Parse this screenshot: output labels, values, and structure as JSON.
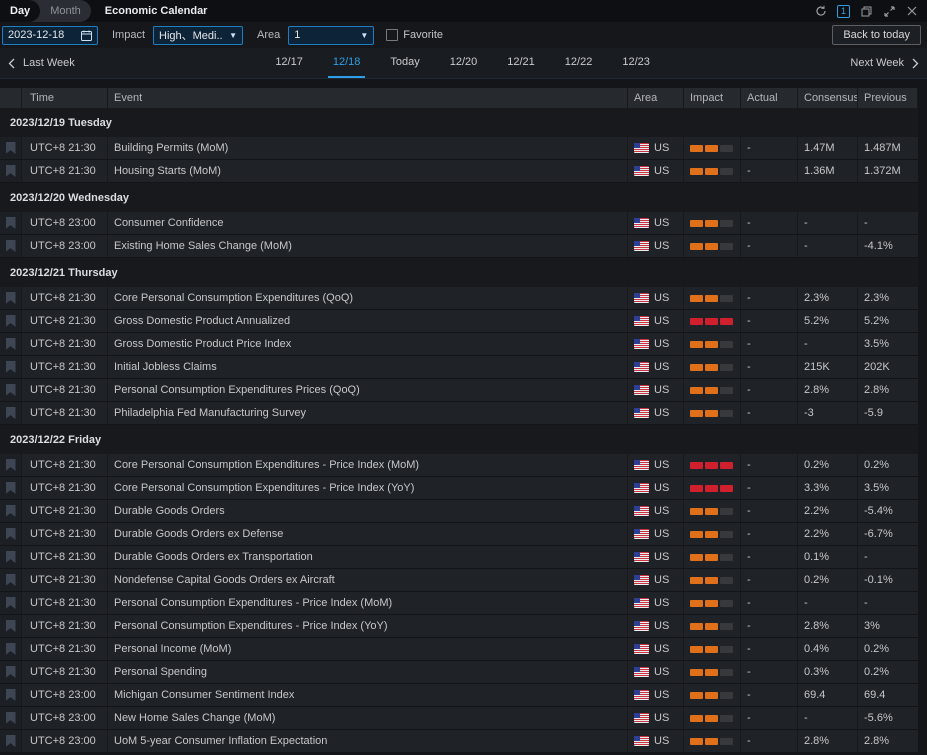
{
  "titlebar": {
    "tabs": [
      {
        "label": "Day",
        "active": true
      },
      {
        "label": "Month",
        "active": false
      }
    ],
    "title": "Economic Calendar",
    "panel_badge": "1",
    "window_icons": [
      "refresh-icon",
      "panel-count-badge",
      "restore-icon",
      "expand-icon",
      "close-icon"
    ],
    "icon_glyphs": {
      "refresh": "⟳",
      "close": "✕"
    }
  },
  "filters": {
    "date_value": "2023-12-18",
    "impact_label": "Impact",
    "impact_value": "High、Medi...",
    "area_label": "Area",
    "area_value": "1",
    "favorite_label": "Favorite",
    "back_to_today_label": "Back to today",
    "caret_glyph": "▼"
  },
  "week_nav": {
    "prev_label": "Last Week",
    "next_label": "Next Week",
    "days": [
      {
        "label": "12/17",
        "selected": false
      },
      {
        "label": "12/18",
        "selected": true
      },
      {
        "label": "Today",
        "selected": false
      },
      {
        "label": "12/20",
        "selected": false
      },
      {
        "label": "12/21",
        "selected": false
      },
      {
        "label": "12/22",
        "selected": false
      },
      {
        "label": "12/23",
        "selected": false
      }
    ]
  },
  "table": {
    "columns": [
      "Time",
      "Event",
      "Area",
      "Impact",
      "Actual",
      "Consensus",
      "Previous"
    ],
    "sections": [
      {
        "date": "2023/12/19 Tuesday",
        "rows": [
          {
            "time": "UTC+8 21:30",
            "event": "Building Permits (MoM)",
            "area": "US",
            "impact": "medium",
            "actual": "-",
            "consensus": "1.47M",
            "previous": "1.487M"
          },
          {
            "time": "UTC+8 21:30",
            "event": "Housing Starts (MoM)",
            "area": "US",
            "impact": "medium",
            "actual": "-",
            "consensus": "1.36M",
            "previous": "1.372M"
          }
        ]
      },
      {
        "date": "2023/12/20 Wednesday",
        "rows": [
          {
            "time": "UTC+8 23:00",
            "event": "Consumer Confidence",
            "area": "US",
            "impact": "medium",
            "actual": "-",
            "consensus": "-",
            "previous": "-"
          },
          {
            "time": "UTC+8 23:00",
            "event": "Existing Home Sales Change (MoM)",
            "area": "US",
            "impact": "medium",
            "actual": "-",
            "consensus": "-",
            "previous": "-4.1%"
          }
        ]
      },
      {
        "date": "2023/12/21 Thursday",
        "rows": [
          {
            "time": "UTC+8 21:30",
            "event": "Core Personal Consumption Expenditures (QoQ)",
            "area": "US",
            "impact": "medium",
            "actual": "-",
            "consensus": "2.3%",
            "previous": "2.3%"
          },
          {
            "time": "UTC+8 21:30",
            "event": "Gross Domestic Product Annualized",
            "area": "US",
            "impact": "high",
            "actual": "-",
            "consensus": "5.2%",
            "previous": "5.2%"
          },
          {
            "time": "UTC+8 21:30",
            "event": "Gross Domestic Product Price Index",
            "area": "US",
            "impact": "medium",
            "actual": "-",
            "consensus": "-",
            "previous": "3.5%"
          },
          {
            "time": "UTC+8 21:30",
            "event": "Initial Jobless Claims",
            "area": "US",
            "impact": "medium",
            "actual": "-",
            "consensus": "215K",
            "previous": "202K"
          },
          {
            "time": "UTC+8 21:30",
            "event": "Personal Consumption Expenditures Prices (QoQ)",
            "area": "US",
            "impact": "medium",
            "actual": "-",
            "consensus": "2.8%",
            "previous": "2.8%"
          },
          {
            "time": "UTC+8 21:30",
            "event": "Philadelphia Fed Manufacturing Survey",
            "area": "US",
            "impact": "medium",
            "actual": "-",
            "consensus": "-3",
            "previous": "-5.9"
          }
        ]
      },
      {
        "date": "2023/12/22 Friday",
        "rows": [
          {
            "time": "UTC+8 21:30",
            "event": "Core Personal Consumption Expenditures - Price Index (MoM)",
            "area": "US",
            "impact": "high",
            "actual": "-",
            "consensus": "0.2%",
            "previous": "0.2%"
          },
          {
            "time": "UTC+8 21:30",
            "event": "Core Personal Consumption Expenditures - Price Index (YoY)",
            "area": "US",
            "impact": "high",
            "actual": "-",
            "consensus": "3.3%",
            "previous": "3.5%"
          },
          {
            "time": "UTC+8 21:30",
            "event": "Durable Goods Orders",
            "area": "US",
            "impact": "medium",
            "actual": "-",
            "consensus": "2.2%",
            "previous": "-5.4%"
          },
          {
            "time": "UTC+8 21:30",
            "event": "Durable Goods Orders ex Defense",
            "area": "US",
            "impact": "medium",
            "actual": "-",
            "consensus": "2.2%",
            "previous": "-6.7%"
          },
          {
            "time": "UTC+8 21:30",
            "event": "Durable Goods Orders ex Transportation",
            "area": "US",
            "impact": "medium",
            "actual": "-",
            "consensus": "0.1%",
            "previous": "-"
          },
          {
            "time": "UTC+8 21:30",
            "event": "Nondefense Capital Goods Orders ex Aircraft",
            "area": "US",
            "impact": "medium",
            "actual": "-",
            "consensus": "0.2%",
            "previous": "-0.1%"
          },
          {
            "time": "UTC+8 21:30",
            "event": "Personal Consumption Expenditures - Price Index (MoM)",
            "area": "US",
            "impact": "medium",
            "actual": "-",
            "consensus": "-",
            "previous": "-"
          },
          {
            "time": "UTC+8 21:30",
            "event": "Personal Consumption Expenditures - Price Index (YoY)",
            "area": "US",
            "impact": "medium",
            "actual": "-",
            "consensus": "2.8%",
            "previous": "3%"
          },
          {
            "time": "UTC+8 21:30",
            "event": "Personal Income (MoM)",
            "area": "US",
            "impact": "medium",
            "actual": "-",
            "consensus": "0.4%",
            "previous": "0.2%"
          },
          {
            "time": "UTC+8 21:30",
            "event": "Personal Spending",
            "area": "US",
            "impact": "medium",
            "actual": "-",
            "consensus": "0.3%",
            "previous": "0.2%"
          },
          {
            "time": "UTC+8 23:00",
            "event": "Michigan Consumer Sentiment Index",
            "area": "US",
            "impact": "medium",
            "actual": "-",
            "consensus": "69.4",
            "previous": "69.4"
          },
          {
            "time": "UTC+8 23:00",
            "event": "New Home Sales Change (MoM)",
            "area": "US",
            "impact": "medium",
            "actual": "-",
            "consensus": "-",
            "previous": "-5.6%"
          },
          {
            "time": "UTC+8 23:00",
            "event": "UoM 5-year Consumer Inflation Expectation",
            "area": "US",
            "impact": "medium",
            "actual": "-",
            "consensus": "2.8%",
            "previous": "2.8%"
          }
        ]
      }
    ]
  },
  "colors": {
    "accent_blue": "#2e9fe6",
    "input_border_blue": "#1f7ec2",
    "impact_medium_orange": "#e0701a",
    "impact_high_red": "#d0202e",
    "impact_empty": "#37393d",
    "row_bg": "#1f2226",
    "section_bg": "#17191d",
    "header_bg": "#26292d",
    "titlebar_bg": "#0d0f12"
  }
}
